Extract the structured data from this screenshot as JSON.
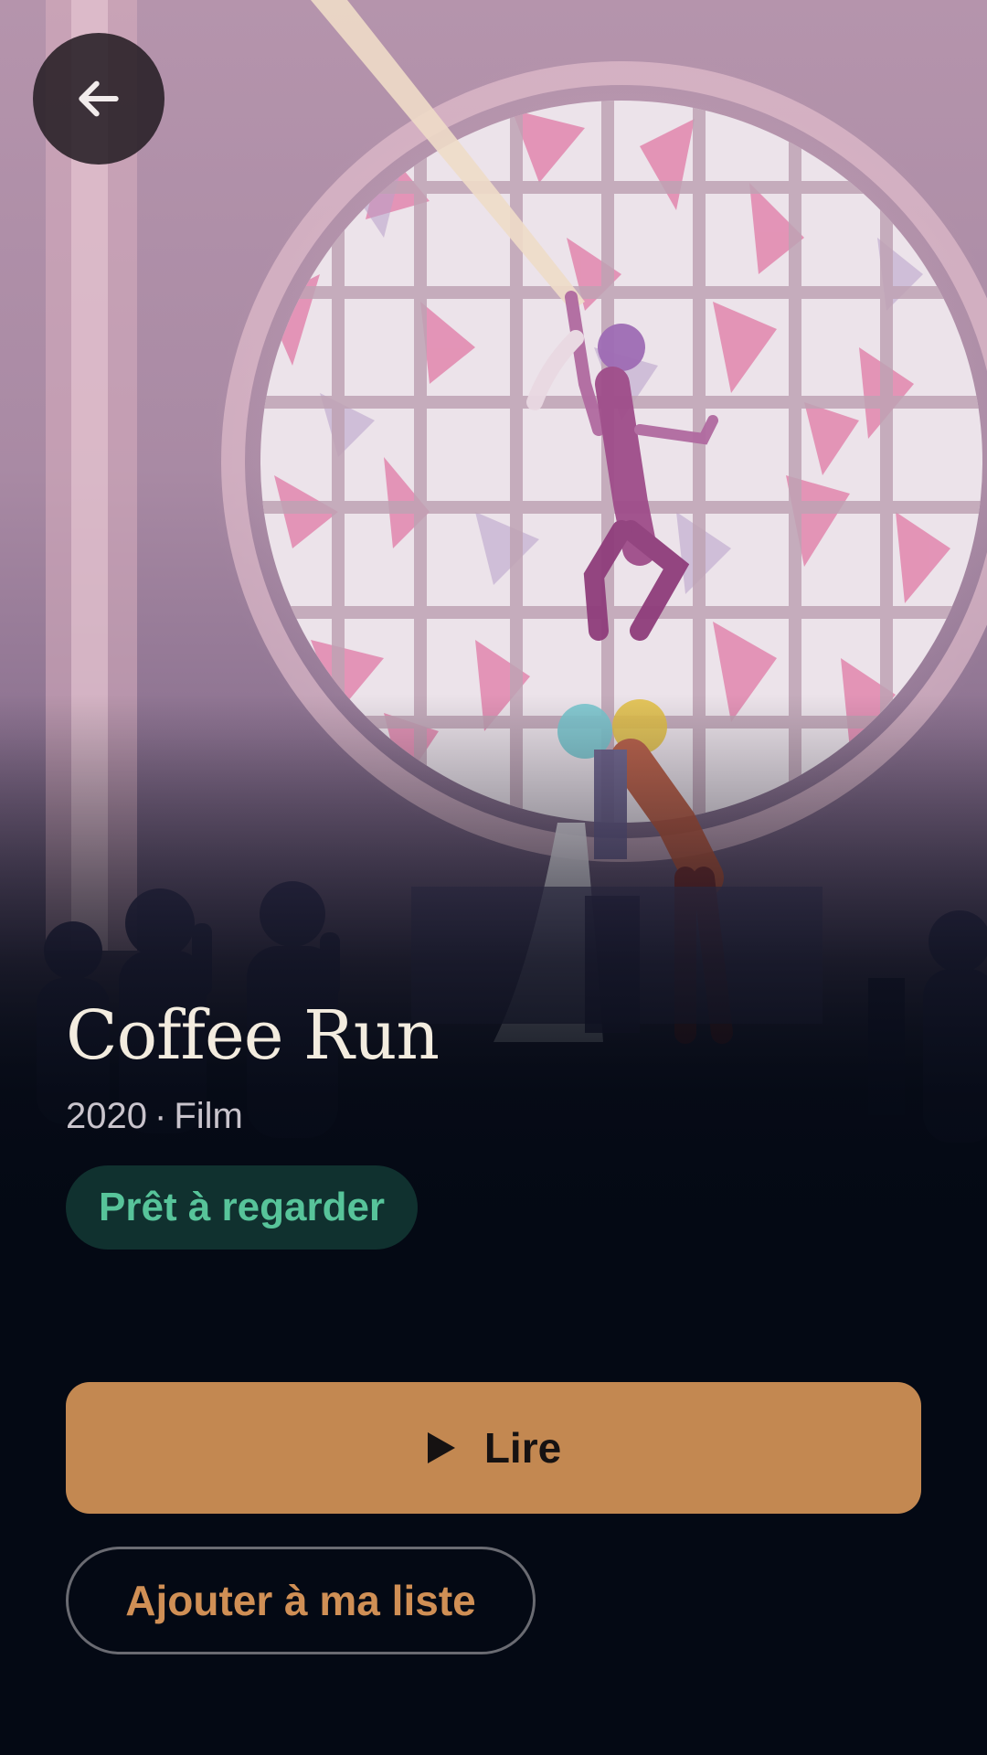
{
  "hero": {
    "artwork": "coffee-run-poster"
  },
  "nav": {
    "back_icon": "arrow-left-icon"
  },
  "movie": {
    "title": "Coffee Run",
    "year": "2020",
    "separator": "·",
    "type": "Film",
    "status": "Prêt à regarder"
  },
  "actions": {
    "play_label": "Lire",
    "play_icon": "play-icon",
    "add_list_label": "Ajouter à ma liste"
  },
  "colors": {
    "background": "#040914",
    "accent": "#c38851",
    "status_text": "#57c49a",
    "status_bg": "#10312f",
    "title_text": "#f3ecdf"
  }
}
